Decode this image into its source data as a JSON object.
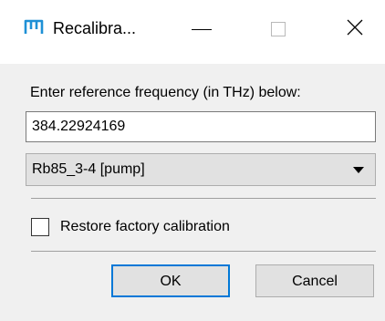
{
  "window": {
    "title": "Recalibra...",
    "icons": {
      "app": "app-logo-icon",
      "minimize": "minimize-icon",
      "maximize": "maximize-icon",
      "close": "close-icon"
    },
    "close_glyph": "✕",
    "accent_color": "#0078d7"
  },
  "dialog": {
    "prompt": "Enter reference frequency (in THz) below:",
    "frequency_value": "384.22924169",
    "reference_select": {
      "selected": "Rb85_3-4 [pump]"
    },
    "restore_checkbox": {
      "label": "Restore factory calibration",
      "checked": false
    },
    "buttons": {
      "ok": "OK",
      "cancel": "Cancel"
    }
  }
}
